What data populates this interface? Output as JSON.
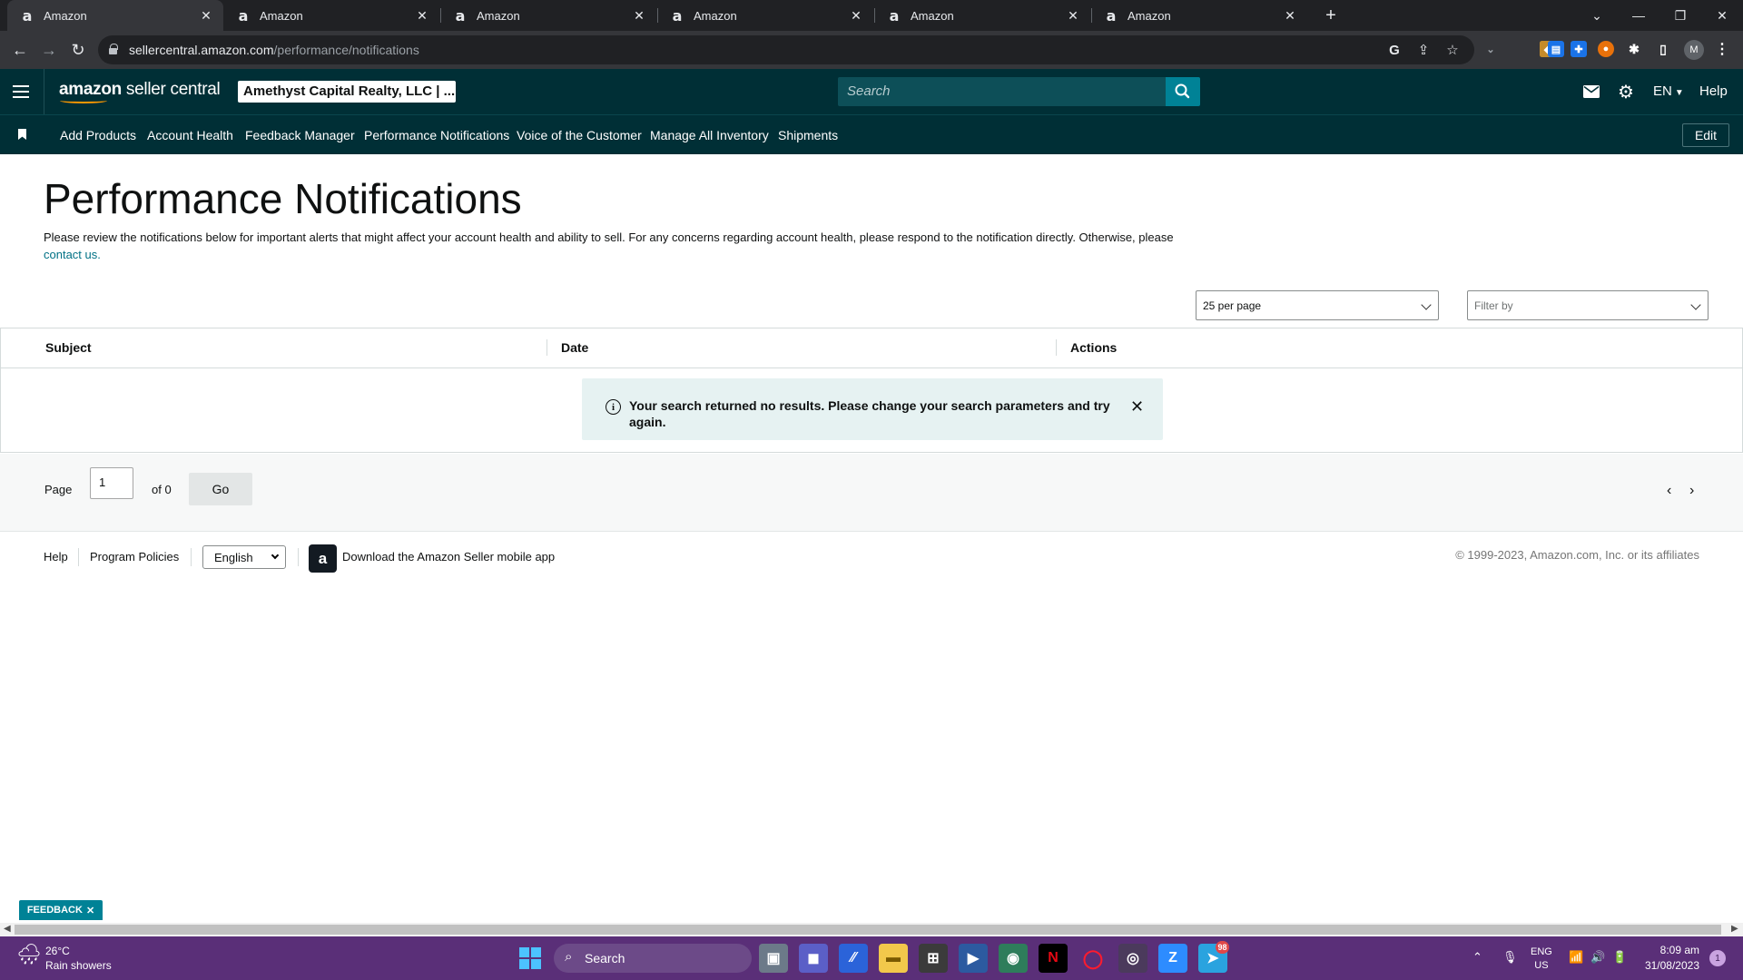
{
  "browser": {
    "tabs": [
      {
        "title": "Amazon"
      },
      {
        "title": "Amazon"
      },
      {
        "title": "Amazon"
      },
      {
        "title": "Amazon"
      },
      {
        "title": "Amazon"
      },
      {
        "title": "Amazon"
      }
    ],
    "url_domain": "sellercentral.amazon.com",
    "url_path": "/performance/notifications",
    "profile_initial": "M"
  },
  "header": {
    "logo_bold": "amazon",
    "logo_rest": " seller central",
    "account": "Amethyst Capital Realty, LLC | ...",
    "search_placeholder": "Search",
    "language": "EN",
    "help": "Help"
  },
  "bookmarks": {
    "items": [
      "Add Products",
      "Account Health",
      "Feedback Manager",
      "Performance Notifications",
      "Voice of the Customer",
      "Manage All Inventory",
      "Shipments"
    ],
    "edit_label": "Edit"
  },
  "main": {
    "title": "Performance Notifications",
    "description": "Please review the notifications below for important alerts that might affect your account health and ability to sell. For any concerns regarding account health, please respond to the notification directly. Otherwise, please ",
    "contact_link": "contact us.",
    "per_page": "25 per page",
    "filter_placeholder": "Filter by",
    "columns": [
      "Subject",
      "Date",
      "Actions"
    ],
    "alert": "Your search returned no results. Please change your search parameters and try again."
  },
  "pagination": {
    "page_label": "Page",
    "page_value": "1",
    "of_label": "of 0",
    "go_label": "Go"
  },
  "footer": {
    "help": "Help",
    "program_policies": "Program Policies",
    "language": "English",
    "app_download": "Download the Amazon Seller mobile app",
    "copyright": "© 1999-2023, Amazon.com, Inc. or its affiliates"
  },
  "feedback_label": "FEEDBACK",
  "taskbar": {
    "temperature": "26°C",
    "weather": "Rain showers",
    "search": "Search",
    "telegram_badge": "98",
    "lang_top": "ENG",
    "lang_bottom": "US",
    "time": "8:09 am",
    "date": "31/08/2023",
    "notification_count": "1"
  },
  "colors": {
    "header_bg": "#002f36",
    "accent": "#008296",
    "alert_bg": "#e6f2f2",
    "link": "#007185",
    "taskbar_bg": "#5a2f78"
  }
}
